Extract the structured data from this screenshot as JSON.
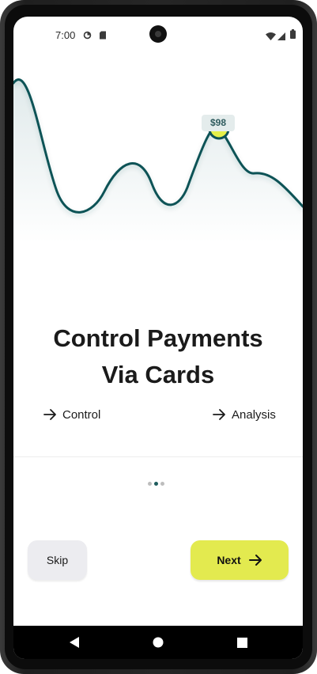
{
  "status_bar": {
    "time": "7:00",
    "left_icons": [
      "sync-icon",
      "sd-card-icon"
    ],
    "right_icons": [
      "wifi-icon",
      "signal-icon",
      "battery-icon"
    ]
  },
  "chart": {
    "price_label": "$98",
    "line_color": "#0d5257",
    "marker_color": "#e6f04a"
  },
  "onboarding": {
    "title_line1": "Control Payments",
    "title_line2": "Via Cards",
    "features": [
      {
        "label": "Control",
        "icon": "arrow-right-icon"
      },
      {
        "label": "Analysis",
        "icon": "arrow-right-icon"
      }
    ],
    "pager": {
      "total": 3,
      "active_index": 1
    }
  },
  "actions": {
    "skip_label": "Skip",
    "next_label": "Next",
    "next_icon": "arrow-right-icon",
    "next_color": "#e3ea4f"
  },
  "nav_bar": {
    "buttons": [
      "back-icon",
      "home-icon",
      "recents-icon"
    ]
  }
}
